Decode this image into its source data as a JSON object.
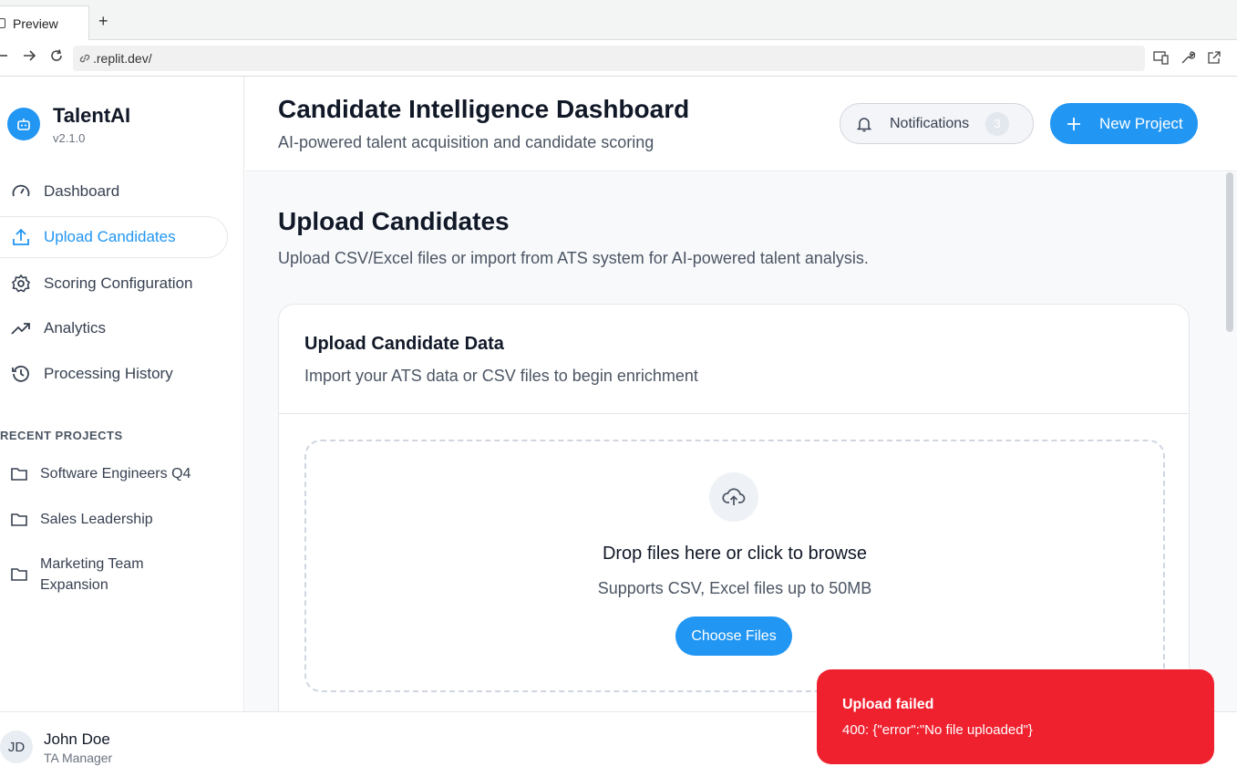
{
  "browser": {
    "tab_label": "Preview",
    "new_tab": "+",
    "url": ".replit.dev/"
  },
  "brand": {
    "name": "TalentAI",
    "version": "v2.1.0"
  },
  "nav": [
    {
      "label": "Dashboard",
      "icon": "gauge-icon"
    },
    {
      "label": "Upload Candidates",
      "icon": "upload-icon",
      "active": true
    },
    {
      "label": "Scoring Configuration",
      "icon": "gear-icon"
    },
    {
      "label": "Analytics",
      "icon": "trending-up-icon"
    },
    {
      "label": "Processing History",
      "icon": "history-icon"
    }
  ],
  "recent": {
    "heading": "RECENT PROJECTS",
    "items": [
      "Software Engineers Q4",
      "Sales Leadership",
      "Marketing Team Expansion"
    ]
  },
  "user": {
    "initials": "JD",
    "name": "John Doe",
    "role": "TA Manager"
  },
  "header": {
    "title": "Candidate Intelligence Dashboard",
    "subtitle": "AI-powered talent acquisition and candidate scoring",
    "notifications_label": "Notifications",
    "notifications_count": "3",
    "new_project_label": "New Project"
  },
  "section": {
    "title": "Upload Candidates",
    "subtitle": "Upload CSV/Excel files or import from ATS system for AI-powered talent analysis."
  },
  "card": {
    "title": "Upload Candidate Data",
    "subtitle": "Import your ATS data or CSV files to begin enrichment",
    "drop_title": "Drop files here or click to browse",
    "drop_sub": "Supports CSV, Excel files up to 50MB",
    "choose_label": "Choose Files"
  },
  "toast": {
    "title": "Upload failed",
    "message": "400: {\"error\":\"No file uploaded\"}"
  },
  "colors": {
    "accent": "#2196f3",
    "error": "#f0212f"
  }
}
